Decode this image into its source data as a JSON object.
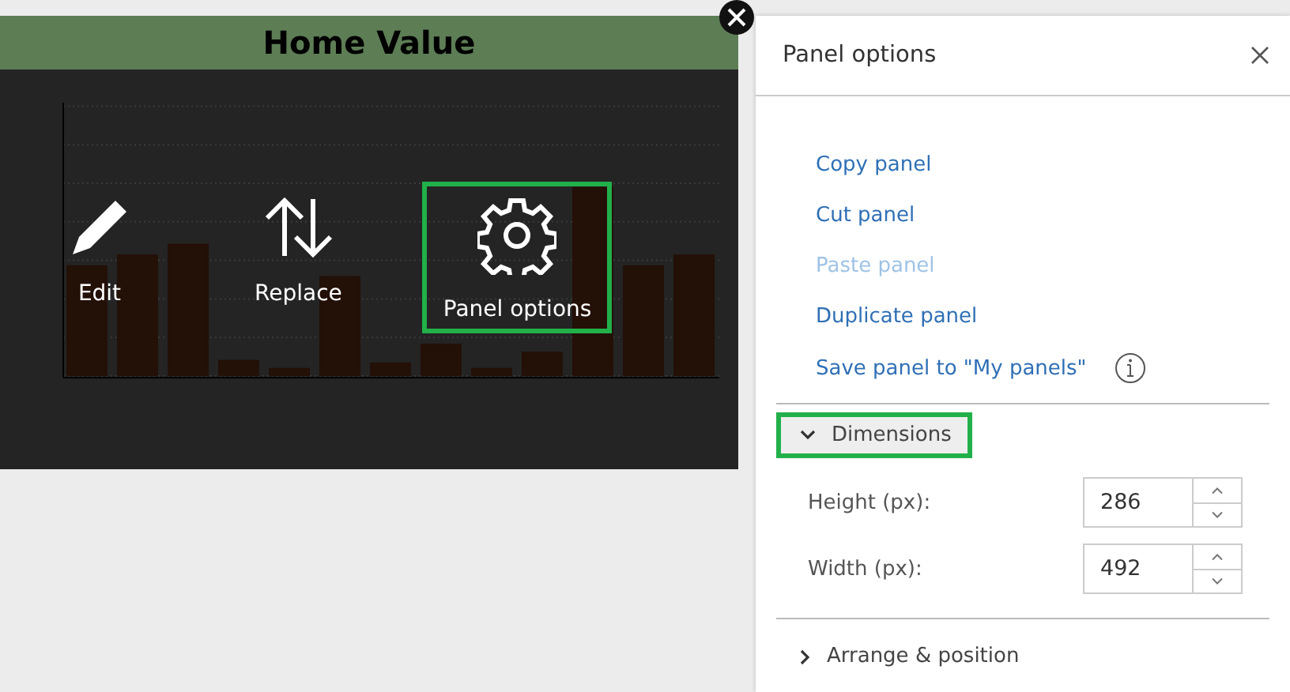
{
  "card": {
    "title": "Home Value"
  },
  "actions": [
    {
      "kind": "edit",
      "label": "Edit",
      "highlighted": false
    },
    {
      "kind": "replace",
      "label": "Replace",
      "highlighted": false
    },
    {
      "kind": "options",
      "label": "Panel options",
      "highlighted": true
    }
  ],
  "panel": {
    "title": "Panel options",
    "menu": [
      {
        "label": "Copy panel",
        "disabled": false,
        "info": false
      },
      {
        "label": "Cut panel",
        "disabled": false,
        "info": false
      },
      {
        "label": "Paste panel",
        "disabled": true,
        "info": false
      },
      {
        "label": "Duplicate panel",
        "disabled": false,
        "info": false
      },
      {
        "label": "Save panel to \"My panels\"",
        "disabled": false,
        "info": true
      }
    ],
    "sections": [
      {
        "label": "Dimensions",
        "expanded": true,
        "highlighted": true,
        "fields": [
          {
            "label": "Height (px):",
            "value": "286"
          },
          {
            "label": "Width (px):",
            "value": "492"
          }
        ]
      },
      {
        "label": "Arrange & position",
        "expanded": false,
        "highlighted": false
      }
    ]
  }
}
